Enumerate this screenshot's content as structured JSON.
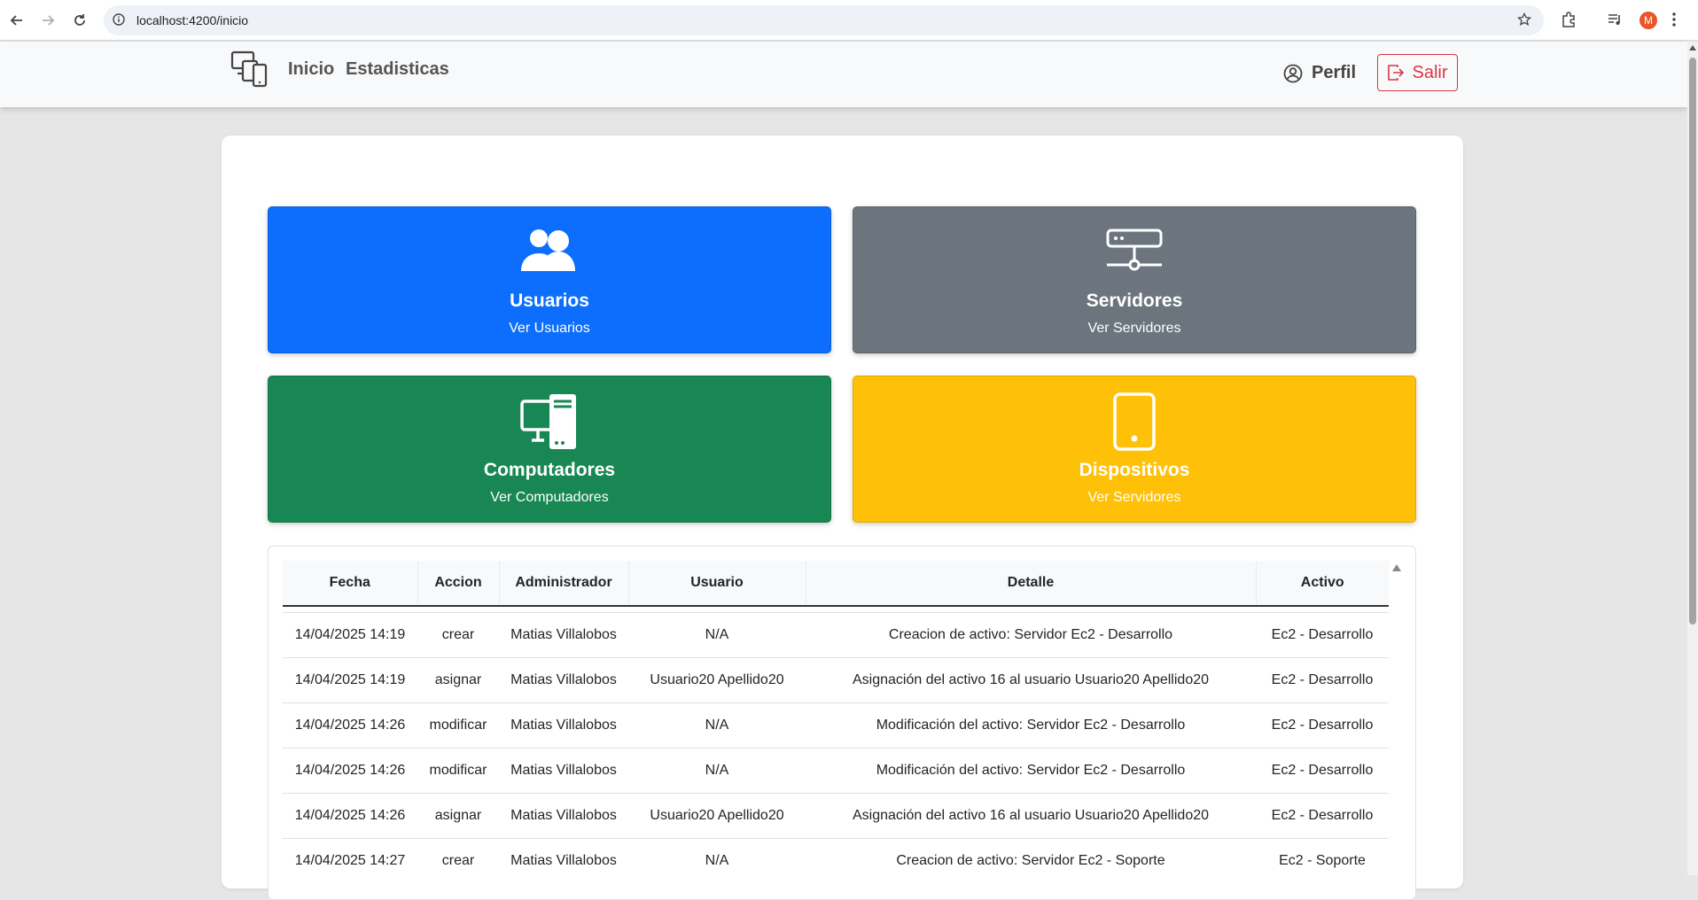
{
  "browser": {
    "url": "localhost:4200/inicio",
    "profile_initial": "M"
  },
  "navbar": {
    "links": [
      "Inicio",
      "Estadisticas"
    ],
    "perfil_label": "Perfil",
    "salir_label": "Salir"
  },
  "tiles": [
    {
      "title": "Usuarios",
      "subtitle": "Ver Usuarios",
      "color": "#0d6efd",
      "icon": "users-icon"
    },
    {
      "title": "Servidores",
      "subtitle": "Ver Servidores",
      "color": "#6c757d",
      "icon": "server-icon"
    },
    {
      "title": "Computadores",
      "subtitle": "Ver Computadores",
      "color": "#198754",
      "icon": "computer-icon"
    },
    {
      "title": "Dispositivos",
      "subtitle": "Ver Servidores",
      "color": "#ffc107",
      "icon": "tablet-icon"
    }
  ],
  "table": {
    "headers": [
      "Fecha",
      "Accion",
      "Administrador",
      "Usuario",
      "Detalle",
      "Activo"
    ],
    "rows": [
      [
        "14/04/2025 14:19",
        "crear",
        "Matias Villalobos",
        "N/A",
        "Creacion de activo: Servidor Ec2 - Desarrollo",
        "Ec2 - Desarrollo"
      ],
      [
        "14/04/2025 14:19",
        "asignar",
        "Matias Villalobos",
        "Usuario20 Apellido20",
        "Asignación del activo 16 al usuario Usuario20 Apellido20",
        "Ec2 - Desarrollo"
      ],
      [
        "14/04/2025 14:26",
        "modificar",
        "Matias Villalobos",
        "N/A",
        "Modificación del activo: Servidor Ec2 - Desarrollo",
        "Ec2 - Desarrollo"
      ],
      [
        "14/04/2025 14:26",
        "modificar",
        "Matias Villalobos",
        "N/A",
        "Modificación del activo: Servidor Ec2 - Desarrollo",
        "Ec2 - Desarrollo"
      ],
      [
        "14/04/2025 14:26",
        "asignar",
        "Matias Villalobos",
        "Usuario20 Apellido20",
        "Asignación del activo 16 al usuario Usuario20 Apellido20",
        "Ec2 - Desarrollo"
      ],
      [
        "14/04/2025 14:27",
        "crear",
        "Matias Villalobos",
        "N/A",
        "Creacion de activo: Servidor Ec2 - Soporte",
        "Ec2 - Soporte"
      ]
    ]
  }
}
